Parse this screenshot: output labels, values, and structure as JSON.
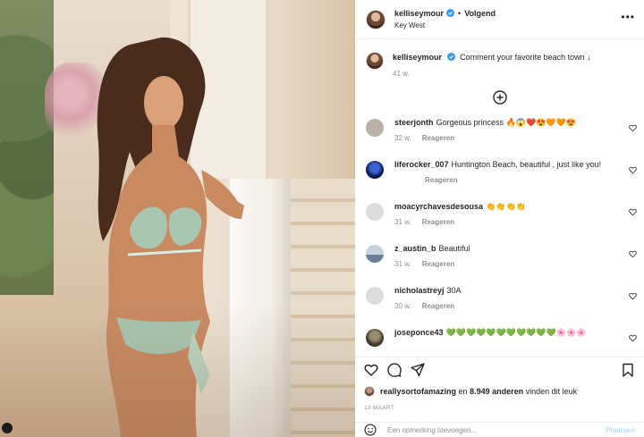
{
  "post": {
    "username": "kelliseymour",
    "follow_label": "Volgend",
    "dot": "•",
    "location": "Key West",
    "more_label": "•••"
  },
  "caption": {
    "username": "kelliseymour",
    "text": "Comment your favorite beach town ↓",
    "age": "41 w."
  },
  "comments": [
    {
      "username": "steerjonth",
      "text": "Gorgeous princess 🔥😱❤️😍🧡🧡😍",
      "age": "32 w.",
      "reply": "Reageren",
      "avatar_color": "#b9b0a6"
    },
    {
      "username": "liferocker_007",
      "text": "Huntington Beach, beautiful , just like you!",
      "age": "",
      "reply": "Reageren",
      "avatar_color": "#1b2a6b"
    },
    {
      "username": "moacyrchavesdesousa",
      "text": "👏👏👏👏",
      "age": "31 w.",
      "reply": "Reageren",
      "avatar_color": "#dbdbdb"
    },
    {
      "username": "z_austin_b",
      "text": "Beautiful",
      "age": "31 w.",
      "reply": "Reageren",
      "avatar_color": "#8fa2b8"
    },
    {
      "username": "nicholastreyj",
      "text": "30A",
      "age": "30 w.",
      "reply": "Reageren",
      "avatar_color": "#dbdbdb"
    },
    {
      "username": "joseponce43",
      "text": "💚💚💚💚💚💚💚💚💚💚💚🌸🌸🌸",
      "age": "",
      "reply": "",
      "avatar_color": "#5a5a4a"
    }
  ],
  "likes": {
    "user": "reallysortofamazing",
    "connector": "en",
    "count": "8.949 anderen",
    "suffix": "vinden dit leuk"
  },
  "date": "13 MAART",
  "add_comment": {
    "placeholder": "Een opmerking toevoegen...",
    "post_label": "Plaatsen"
  },
  "colors": {
    "verified": "#3897f0",
    "meta": "#8e8e8e",
    "post_btn": "#b2dffc"
  }
}
